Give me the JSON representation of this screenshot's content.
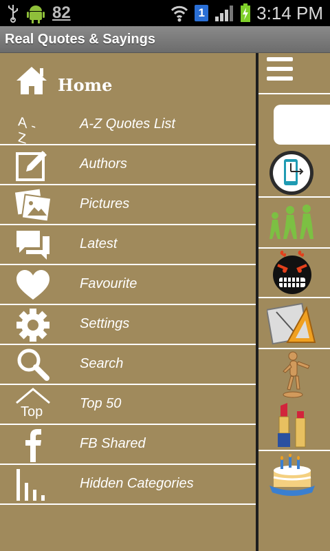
{
  "status_bar": {
    "notification_count": "82",
    "sim_number": "1",
    "time": "3:14 PM"
  },
  "app": {
    "title": "Real Quotes & Sayings"
  },
  "drawer": {
    "home_label": "Home",
    "az_icon_text": "A-Z",
    "top_icon_text": "Top",
    "items": [
      {
        "label": "A-Z Quotes List",
        "icon": "az-icon"
      },
      {
        "label": "Authors",
        "icon": "edit-icon"
      },
      {
        "label": "Pictures",
        "icon": "pictures-icon"
      },
      {
        "label": "Latest",
        "icon": "chat-icon"
      },
      {
        "label": "Favourite",
        "icon": "heart-icon"
      },
      {
        "label": "Settings",
        "icon": "gear-icon"
      },
      {
        "label": "Search",
        "icon": "search-icon"
      },
      {
        "label": "Top 50",
        "icon": "top-icon"
      },
      {
        "label": "FB Shared",
        "icon": "facebook-icon"
      },
      {
        "label": "Hidden Categories",
        "icon": "bars-icon"
      }
    ]
  },
  "colors": {
    "background": "#a08a5c",
    "title_bar": "#7a7a7a",
    "accent_green": "#7cc043"
  }
}
